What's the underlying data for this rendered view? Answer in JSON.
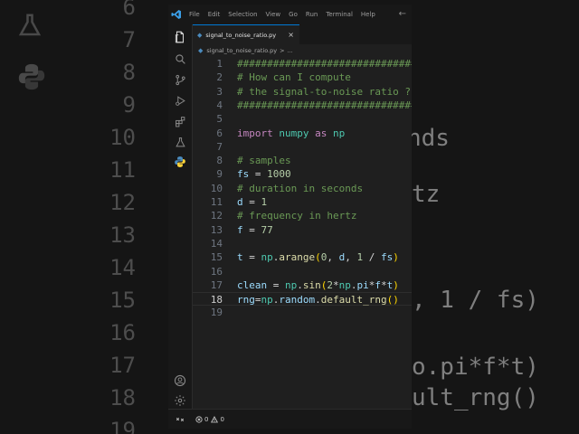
{
  "background": {
    "line_numbers": [
      "6",
      "7",
      "8",
      "9",
      "10",
      "11",
      "12",
      "13",
      "14",
      "15",
      "16",
      "17",
      "18",
      "19"
    ],
    "code_fragments": [
      "nds",
      "tz",
      ", 1 / fs)",
      "o.pi*f*t)",
      "ult_rng()"
    ]
  },
  "menu": [
    "File",
    "Edit",
    "Selection",
    "View",
    "Go",
    "Run",
    "Terminal",
    "Help"
  ],
  "tab": {
    "label": "signal_to_noise_ratio.py",
    "close": "×"
  },
  "breadcrumb": {
    "file": "signal_to_noise_ratio.py",
    "separator": ">",
    "more": "..."
  },
  "editor": {
    "current_line": 18,
    "lines": [
      {
        "n": "1",
        "tokens": [
          {
            "t": "################################",
            "c": "c-cmt"
          }
        ]
      },
      {
        "n": "2",
        "tokens": [
          {
            "t": "# How can I compute",
            "c": "c-cmt"
          }
        ]
      },
      {
        "n": "3",
        "tokens": [
          {
            "t": "# the signal-to-noise ratio ??!",
            "c": "c-cmt"
          }
        ]
      },
      {
        "n": "4",
        "tokens": [
          {
            "t": "################################",
            "c": "c-cmt"
          }
        ]
      },
      {
        "n": "5",
        "tokens": []
      },
      {
        "n": "6",
        "tokens": [
          {
            "t": "import",
            "c": "c-kw"
          },
          {
            "t": " ",
            "c": "c-op"
          },
          {
            "t": "numpy",
            "c": "c-mod"
          },
          {
            "t": " ",
            "c": "c-op"
          },
          {
            "t": "as",
            "c": "c-kw"
          },
          {
            "t": " ",
            "c": "c-op"
          },
          {
            "t": "np",
            "c": "c-mod"
          }
        ]
      },
      {
        "n": "7",
        "tokens": []
      },
      {
        "n": "8",
        "tokens": [
          {
            "t": "# samples",
            "c": "c-cmt"
          }
        ]
      },
      {
        "n": "9",
        "tokens": [
          {
            "t": "fs",
            "c": "c-var"
          },
          {
            "t": " = ",
            "c": "c-op"
          },
          {
            "t": "1000",
            "c": "c-num"
          }
        ]
      },
      {
        "n": "10",
        "tokens": [
          {
            "t": "# duration in seconds",
            "c": "c-cmt"
          }
        ]
      },
      {
        "n": "11",
        "tokens": [
          {
            "t": "d",
            "c": "c-var"
          },
          {
            "t": " = ",
            "c": "c-op"
          },
          {
            "t": "1",
            "c": "c-num"
          }
        ]
      },
      {
        "n": "12",
        "tokens": [
          {
            "t": "# frequency in hertz",
            "c": "c-cmt"
          }
        ]
      },
      {
        "n": "13",
        "tokens": [
          {
            "t": "f",
            "c": "c-var"
          },
          {
            "t": " = ",
            "c": "c-op"
          },
          {
            "t": "77",
            "c": "c-num"
          }
        ]
      },
      {
        "n": "14",
        "tokens": []
      },
      {
        "n": "15",
        "tokens": [
          {
            "t": "t",
            "c": "c-var"
          },
          {
            "t": " = ",
            "c": "c-op"
          },
          {
            "t": "np",
            "c": "c-mod"
          },
          {
            "t": ".",
            "c": "c-op"
          },
          {
            "t": "arange",
            "c": "c-fn"
          },
          {
            "t": "(",
            "c": "c-br1"
          },
          {
            "t": "0",
            "c": "c-num"
          },
          {
            "t": ", ",
            "c": "c-op"
          },
          {
            "t": "d",
            "c": "c-var"
          },
          {
            "t": ", ",
            "c": "c-op"
          },
          {
            "t": "1",
            "c": "c-num"
          },
          {
            "t": " / ",
            "c": "c-op"
          },
          {
            "t": "fs",
            "c": "c-var"
          },
          {
            "t": ")",
            "c": "c-br1"
          }
        ]
      },
      {
        "n": "16",
        "tokens": []
      },
      {
        "n": "17",
        "tokens": [
          {
            "t": "clean",
            "c": "c-var"
          },
          {
            "t": " = ",
            "c": "c-op"
          },
          {
            "t": "np",
            "c": "c-mod"
          },
          {
            "t": ".",
            "c": "c-op"
          },
          {
            "t": "sin",
            "c": "c-fn"
          },
          {
            "t": "(",
            "c": "c-br1"
          },
          {
            "t": "2",
            "c": "c-num"
          },
          {
            "t": "*",
            "c": "c-op"
          },
          {
            "t": "np",
            "c": "c-mod"
          },
          {
            "t": ".",
            "c": "c-op"
          },
          {
            "t": "pi",
            "c": "c-var"
          },
          {
            "t": "*",
            "c": "c-op"
          },
          {
            "t": "f",
            "c": "c-var"
          },
          {
            "t": "*",
            "c": "c-op"
          },
          {
            "t": "t",
            "c": "c-var"
          },
          {
            "t": ")",
            "c": "c-br1"
          }
        ]
      },
      {
        "n": "18",
        "tokens": [
          {
            "t": "rng",
            "c": "c-var"
          },
          {
            "t": "=",
            "c": "c-op"
          },
          {
            "t": "np",
            "c": "c-mod"
          },
          {
            "t": ".",
            "c": "c-op"
          },
          {
            "t": "random",
            "c": "c-var"
          },
          {
            "t": ".",
            "c": "c-op"
          },
          {
            "t": "default_rng",
            "c": "c-fn"
          },
          {
            "t": "(",
            "c": "c-br1"
          },
          {
            "t": ")",
            "c": "c-br1"
          }
        ]
      },
      {
        "n": "19",
        "tokens": []
      }
    ]
  },
  "status": {
    "errors": "0",
    "warnings": "0"
  },
  "colors": {
    "accent": "#0078d4",
    "python_blue": "#4b8bbe",
    "python_yellow": "#ffd43b"
  }
}
